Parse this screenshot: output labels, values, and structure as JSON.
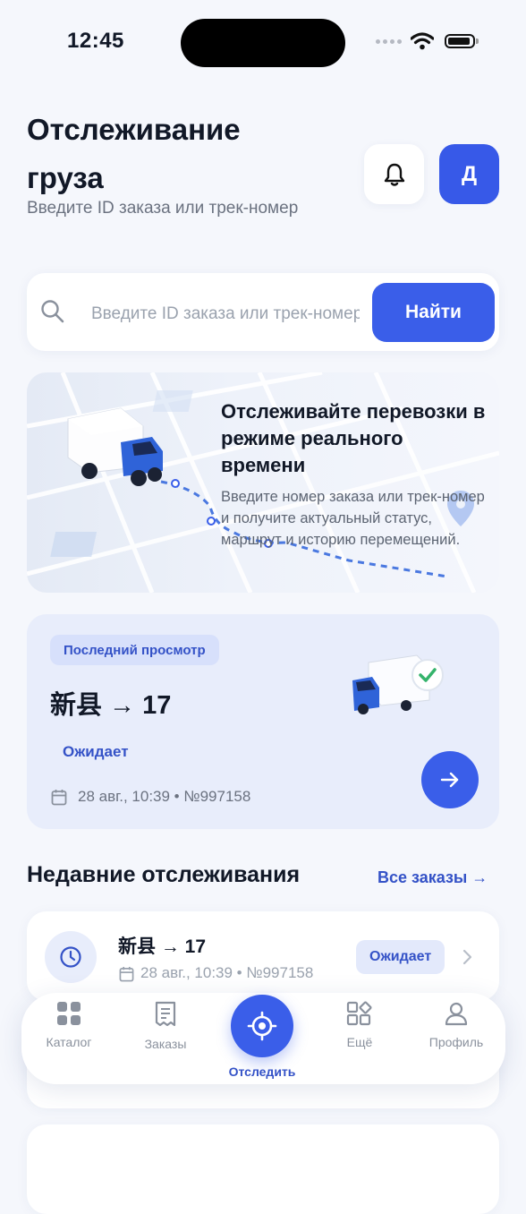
{
  "status_bar": {
    "time": "12:45"
  },
  "header": {
    "title": "Отслеживание груза",
    "subtitle": "Введите ID заказа или трек-номер",
    "avatar_initial": "Д"
  },
  "search": {
    "placeholder": "Введите ID заказа или трек-номер",
    "button_label": "Найти"
  },
  "promo": {
    "title": "Отслеживайте перевозки в режиме реального времени",
    "text": "Введите номер заказа или трек-номер и получите актуальный статус, маршрут и историю перемещений."
  },
  "last_viewed": {
    "badge": "Последний просмотр",
    "route": "新县 → 17",
    "status": "Ожидает",
    "meta": "28 авг., 10:39 • №997158"
  },
  "recent": {
    "title": "Недавние отслеживания",
    "all_link": "Все заказы →",
    "items": [
      {
        "route": "新县 → 17",
        "meta": "28 авг., 10:39 • №997158",
        "status": "Ожидает"
      }
    ]
  },
  "bottom_nav": {
    "items": [
      {
        "label": "Каталог",
        "icon": "grid-icon"
      },
      {
        "label": "Заказы",
        "icon": "receipt-icon"
      },
      {
        "label": "Отследить",
        "icon": "target-icon",
        "active": true
      },
      {
        "label": "Ещё",
        "icon": "more-apps-icon"
      },
      {
        "label": "Профиль",
        "icon": "user-icon"
      }
    ]
  },
  "colors": {
    "accent": "#3a5ee9",
    "accent_text": "#3452c7",
    "background": "#f5f7fc"
  }
}
